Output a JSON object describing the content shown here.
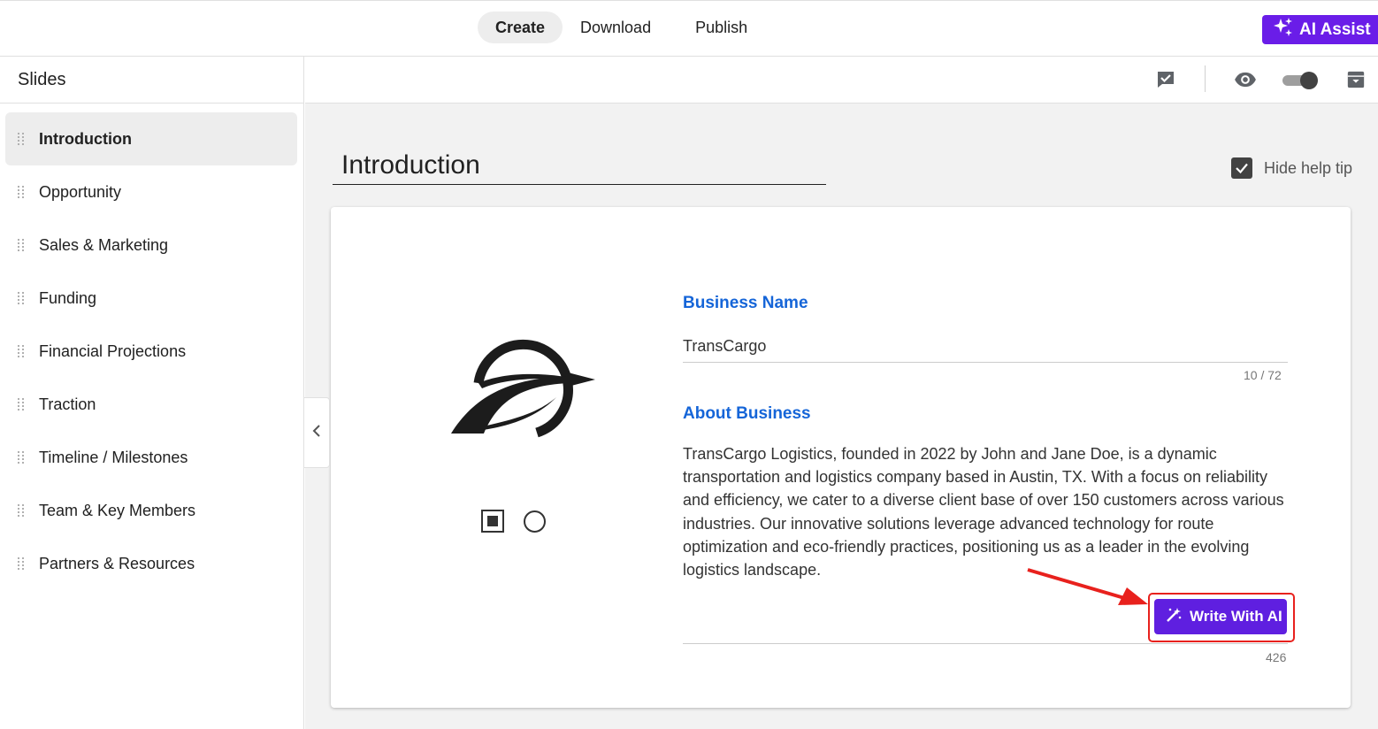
{
  "topbar": {
    "tabs": [
      {
        "label": "Create",
        "active": true
      },
      {
        "label": "Download",
        "active": false
      },
      {
        "label": "Publish",
        "active": false
      }
    ],
    "ai_assist_label": "AI Assist",
    "accent": "#6a1de8"
  },
  "sidebar": {
    "title": "Slides",
    "items": [
      {
        "label": "Introduction",
        "active": true
      },
      {
        "label": "Opportunity"
      },
      {
        "label": "Sales & Marketing"
      },
      {
        "label": "Funding"
      },
      {
        "label": "Financial Projections"
      },
      {
        "label": "Traction"
      },
      {
        "label": "Timeline / Milestones"
      },
      {
        "label": "Team & Key Members"
      },
      {
        "label": "Partners & Resources"
      }
    ]
  },
  "toolbar": {
    "icons": [
      "comment-check-icon",
      "eye-icon",
      "toggle-switch",
      "archive-icon"
    ],
    "toggle_on": true
  },
  "page": {
    "title": "Introduction",
    "hide_help_tip_label": "Hide help tip",
    "hide_help_tip_checked": true
  },
  "form": {
    "business_name_label": "Business Name",
    "business_name_value": "TransCargo",
    "business_name_counter": "10 / 72",
    "about_label": "About Business",
    "about_value": "TransCargo Logistics, founded in 2022 by John and Jane Doe, is a dynamic transportation and logistics company based in Austin, TX. With a focus on reliability and efficiency, we cater to a diverse client base of over 150 customers across various industries. Our innovative solutions leverage advanced technology for route optimization and eco-friendly practices, positioning us as a leader in the evolving logistics landscape.",
    "about_counter": "426",
    "write_ai_label": "Write With AI",
    "label_color": "#1565d8",
    "button_color": "#5f1fe0",
    "highlight_color": "#e8211d"
  }
}
